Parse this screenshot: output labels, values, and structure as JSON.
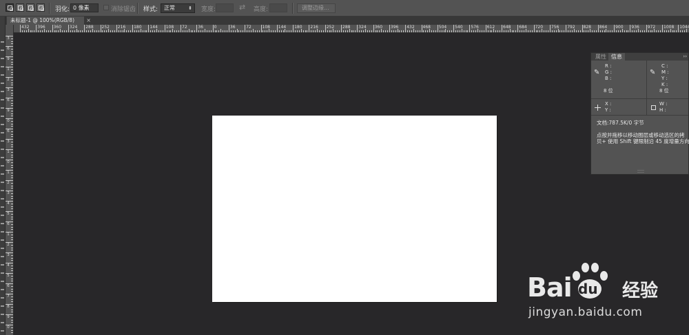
{
  "options_bar": {
    "feather_label": "羽化:",
    "feather_value": "0 像素",
    "antialias_label": "消除锯齿",
    "style_label": "样式:",
    "style_value": "正常",
    "width_label": "宽度:",
    "width_value": "",
    "height_label": "高度:",
    "height_value": "",
    "refine_edge_label": "调整边缘..."
  },
  "document_tab": {
    "title": "未标题-1 @ 100%(RGB/8)",
    "close": "×"
  },
  "rulers": {
    "top_labels": [
      "432",
      "396",
      "360",
      "324",
      "288",
      "252",
      "216",
      "180",
      "144",
      "108",
      "72",
      "36",
      "0",
      "36",
      "72",
      "108",
      "144",
      "180",
      "216",
      "252",
      "288",
      "324",
      "360",
      "396",
      "432",
      "468",
      "504",
      "540",
      "576",
      "612",
      "648",
      "684",
      "720",
      "756",
      "792",
      "828",
      "864",
      "900",
      "936",
      "972",
      "1008",
      "1044"
    ],
    "left_labels": [
      "3",
      "6",
      "9",
      "1",
      "2",
      "3",
      "6",
      "9",
      "0",
      "6",
      "3",
      "1",
      "0",
      "1",
      "2",
      "3",
      "4",
      "5",
      "6",
      "1",
      "2",
      "3",
      "4",
      "5",
      "6",
      "7",
      "8",
      "9",
      "0"
    ]
  },
  "info_panel": {
    "tabs": [
      "属性",
      "信息"
    ],
    "active_tab": "信息",
    "menu_icon": "››",
    "rgb": {
      "r": "R :",
      "g": "G :",
      "b": "B :",
      "bits": "8 位"
    },
    "cmyk": {
      "c": "C :",
      "m": "M :",
      "y": "Y :",
      "k": "K :",
      "bits": "8 位"
    },
    "xy": {
      "x": "X :",
      "y": "Y :"
    },
    "wh": {
      "w": "W :",
      "h": "H :"
    },
    "doc_info": "文档:787.5K/0 字节",
    "hint_line1": "点按并拖移以移动图层或移动选区的拷",
    "hint_line2": "贝+ 使用 Shift 键限制沿 45 度增量方向"
  },
  "watermark": {
    "brand_left": "Bai",
    "brand_right": "du",
    "product": "经验",
    "url": "jingyan.baidu.com"
  }
}
